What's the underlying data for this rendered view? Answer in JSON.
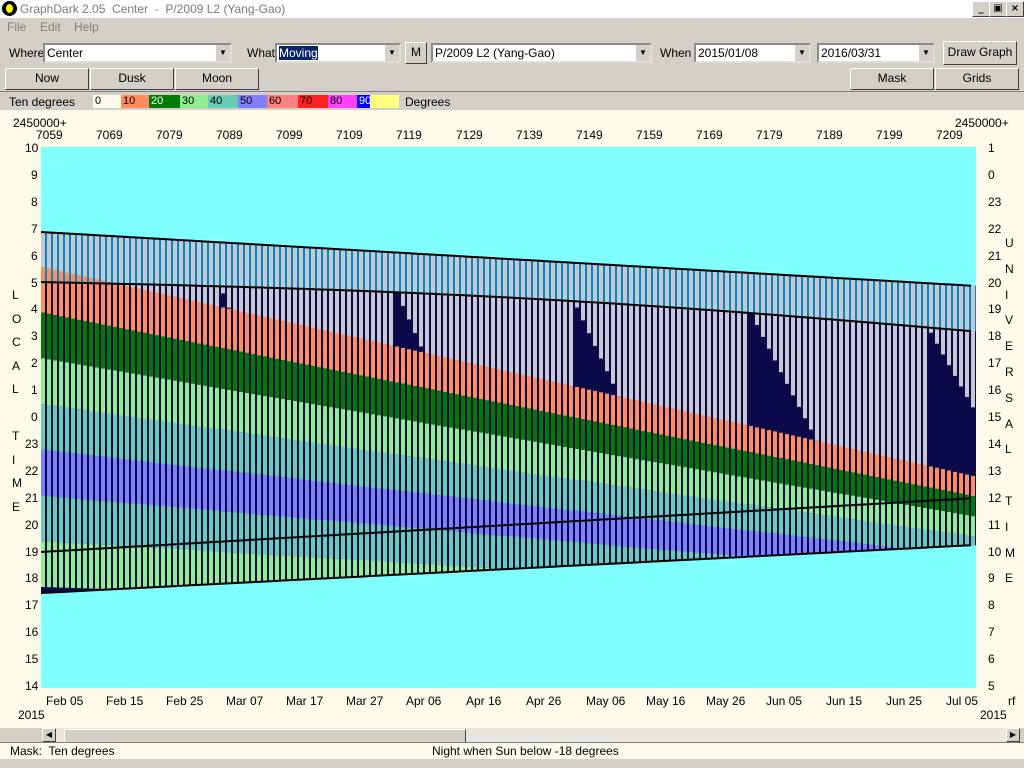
{
  "window": {
    "title": "GraphDark 2.05  Center  -  P/2009 L2 (Yang-Gao)",
    "buttons": [
      "_",
      "▣",
      "×"
    ]
  },
  "menu": [
    {
      "label": "File"
    },
    {
      "label": "Edit"
    },
    {
      "label": "Help"
    }
  ],
  "toolbar": {
    "where_label": "Where",
    "where_value": "Center",
    "what_label": "What",
    "what_value": "Moving",
    "m_button": "M",
    "object_value": "P/2009 L2 (Yang-Gao)",
    "when_label": "When",
    "start_date": "2015/01/08",
    "end_date": "2016/03/31",
    "draw_button": "Draw Graph"
  },
  "buttons_row": {
    "now": "Now",
    "dusk": "Dusk",
    "moon": "Moon",
    "mask": "Mask",
    "grids": "Grids"
  },
  "legend": {
    "title": "Ten degrees",
    "unit": "Degrees",
    "items": [
      {
        "label": "0",
        "color": "#fffbea"
      },
      {
        "label": "10",
        "color": "#ff8c5a"
      },
      {
        "label": "20",
        "color": "#007a00"
      },
      {
        "label": "30",
        "color": "#90ee90"
      },
      {
        "label": "40",
        "color": "#66ccb4"
      },
      {
        "label": "50",
        "color": "#8080ff"
      },
      {
        "label": "60",
        "color": "#ff8080"
      },
      {
        "label": "70",
        "color": "#ff2020"
      },
      {
        "label": "80",
        "color": "#ff40ff"
      },
      {
        "label": "90",
        "color": "#0000ff"
      },
      {
        "label": "",
        "color": "#ffff80"
      }
    ]
  },
  "colors": {
    "plot_bg": "#80ffff",
    "night": "#0a0a4a",
    "twilight": "#0088c8",
    "moon_gray": "#c8c8d0"
  },
  "axes": {
    "jd_prefix_left": "2450000+",
    "jd_prefix_right": "2450000+",
    "jd_ticks": [
      "7059",
      "7069",
      "7079",
      "7089",
      "7099",
      "7109",
      "7119",
      "7129",
      "7139",
      "7149",
      "7159",
      "7169",
      "7179",
      "7189",
      "7199",
      "7209"
    ],
    "date_ticks": [
      "Feb 05",
      "Feb 15",
      "Feb 25",
      "Mar 07",
      "Mar 17",
      "Mar 27",
      "Apr 06",
      "Apr 16",
      "Apr 26",
      "May 06",
      "May 16",
      "May 26",
      "Jun 05",
      "Jun 15",
      "Jun 25",
      "Jul 05"
    ],
    "year_left": "2015",
    "year_right": "2015",
    "left_hours": [
      "10",
      "9",
      "8",
      "7",
      "6",
      "5",
      "4",
      "3",
      "2",
      "1",
      "0",
      "23",
      "22",
      "21",
      "20",
      "19",
      "18",
      "17",
      "16",
      "15",
      "14"
    ],
    "right_hours": [
      "1",
      "0",
      "23",
      "22",
      "21",
      "20",
      "19",
      "18",
      "17",
      "16",
      "15",
      "14",
      "13",
      "12",
      "11",
      "10",
      "9",
      "8",
      "7",
      "6",
      "5"
    ],
    "left_title": [
      "L",
      "O",
      "C",
      "A",
      "L",
      "",
      "T",
      "I",
      "M",
      "E"
    ],
    "right_title": [
      "U",
      "N",
      "I",
      "V",
      "E",
      "R",
      "S",
      "A",
      "L",
      "",
      "T",
      "I",
      "M",
      "E"
    ],
    "corner_right": "rf"
  },
  "status": {
    "mask": "Mask:  Ten degrees",
    "night": "Night when Sun below -18 degrees"
  }
}
